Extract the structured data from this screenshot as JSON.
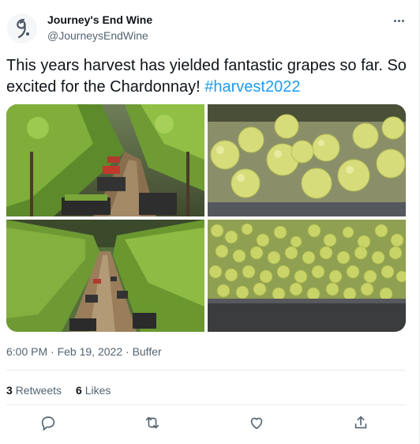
{
  "author": {
    "name": "Journey's End Wine",
    "handle": "@JourneysEndWine",
    "avatar_icon": "journeys-end-logo"
  },
  "tweet": {
    "text": "This years harvest has yielded fantastic grapes so far. So excited for the Chardonnay! ",
    "hashtag": "#harvest2022",
    "time": "6:00 PM",
    "date": "Feb 19, 2022",
    "source": "Buffer",
    "media": [
      {
        "subject": "vineyard rows with harvest crates"
      },
      {
        "subject": "close-up of green chardonnay grapes"
      },
      {
        "subject": "long vineyard row with crates"
      },
      {
        "subject": "crate of harvested white grapes"
      }
    ]
  },
  "stats": {
    "retweets_count": "3",
    "retweets_label": "Retweets",
    "likes_count": "6",
    "likes_label": "Likes"
  },
  "actions": [
    "reply-icon",
    "retweet-icon",
    "like-icon",
    "share-icon"
  ],
  "colors": {
    "link": "#1d9bf0",
    "muted": "#536471",
    "text": "#0f1419",
    "border": "#e6ecf0"
  }
}
